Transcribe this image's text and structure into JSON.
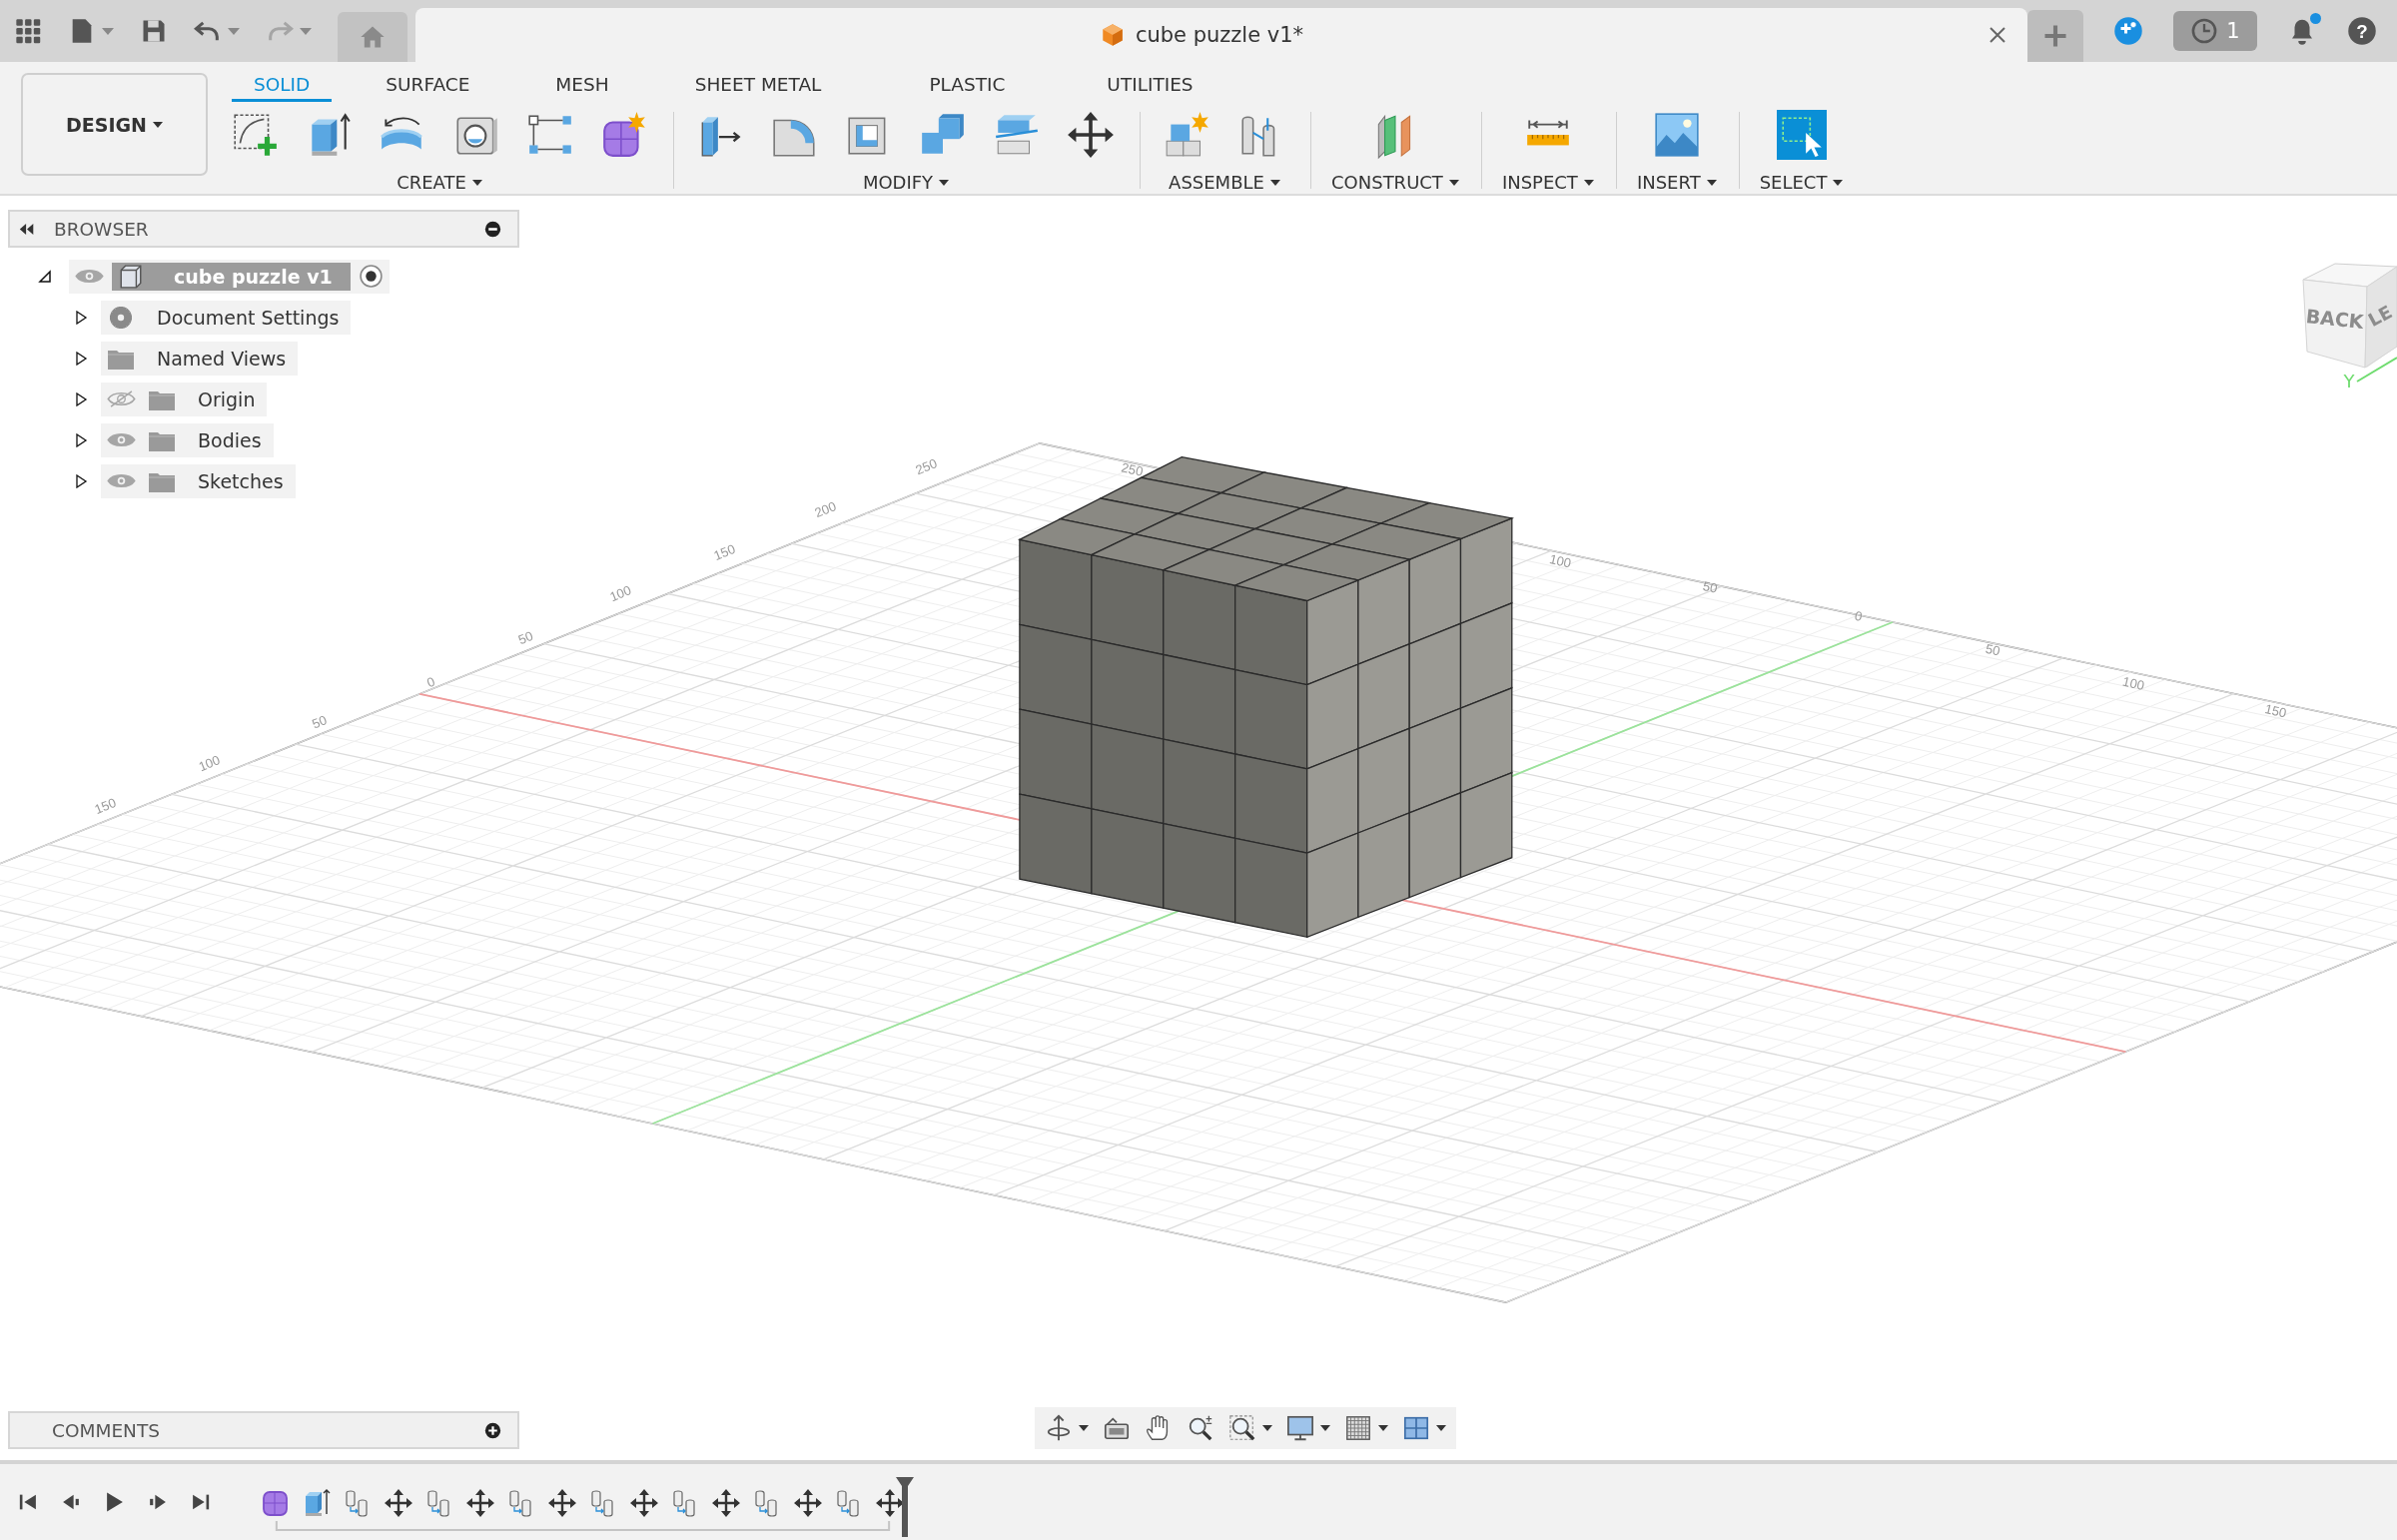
{
  "top_bar": {
    "undo": {
      "disabled": false
    },
    "redo": {
      "disabled": true
    },
    "document_tab": {
      "title": "cube puzzle v1*"
    },
    "job_count": "1",
    "notifications": {
      "unread": true
    },
    "help_label": "?"
  },
  "toolbar": {
    "workspace": "DESIGN",
    "tabs": [
      {
        "label": "SOLID",
        "selected": true
      },
      {
        "label": "SURFACE",
        "selected": false
      },
      {
        "label": "MESH",
        "selected": false
      },
      {
        "label": "SHEET METAL",
        "selected": false
      },
      {
        "label": "PLASTIC",
        "selected": false
      },
      {
        "label": "UTILITIES",
        "selected": false
      }
    ],
    "groups": [
      {
        "label": "CREATE",
        "tools": [
          {
            "kind": "sketch"
          },
          {
            "kind": "extrude"
          },
          {
            "kind": "revolve"
          },
          {
            "kind": "hole"
          },
          {
            "kind": "pattern"
          },
          {
            "kind": "form"
          }
        ]
      },
      {
        "label": "MODIFY",
        "tools": [
          {
            "kind": "press-pull"
          },
          {
            "kind": "fillet"
          },
          {
            "kind": "shell"
          },
          {
            "kind": "combine"
          },
          {
            "kind": "split"
          },
          {
            "kind": "move"
          }
        ]
      },
      {
        "label": "ASSEMBLE",
        "tools": [
          {
            "kind": "new-component"
          },
          {
            "kind": "joint"
          }
        ]
      },
      {
        "label": "CONSTRUCT",
        "tools": [
          {
            "kind": "plane"
          }
        ]
      },
      {
        "label": "INSPECT",
        "tools": [
          {
            "kind": "measure"
          }
        ]
      },
      {
        "label": "INSERT",
        "tools": [
          {
            "kind": "image"
          }
        ]
      },
      {
        "label": "SELECT",
        "tools": [
          {
            "kind": "select"
          }
        ]
      }
    ]
  },
  "browser": {
    "title": "BROWSER",
    "root": {
      "label": "cube puzzle v1",
      "expanded": true,
      "visible": true,
      "active": true,
      "children": [
        {
          "label": "Document Settings",
          "kind": "settings",
          "expanded": false
        },
        {
          "label": "Named Views",
          "kind": "folder",
          "expanded": false
        },
        {
          "label": "Origin",
          "kind": "folder",
          "visible": false,
          "expanded": false
        },
        {
          "label": "Bodies",
          "kind": "folder",
          "visible": true,
          "expanded": false
        },
        {
          "label": "Sketches",
          "kind": "folder",
          "visible": true,
          "expanded": false
        }
      ]
    }
  },
  "viewport": {
    "grid_labels": [
      "250",
      "200",
      "150",
      "100",
      "50",
      "0",
      "50",
      "100",
      "150",
      "250",
      "100",
      "50",
      "0",
      "50",
      "100",
      "150"
    ]
  },
  "viewcube": {
    "faces": [
      "BACK",
      "LE"
    ],
    "axis_label": "Y"
  },
  "comments": {
    "title": "COMMENTS"
  },
  "nav_bar": {
    "tools": [
      {
        "kind": "orbit",
        "menu": true
      },
      {
        "kind": "look-at",
        "menu": false
      },
      {
        "kind": "pan",
        "menu": false
      },
      {
        "kind": "zoom",
        "menu": false
      },
      {
        "kind": "fit",
        "menu": true
      },
      {
        "kind": "display",
        "menu": true
      },
      {
        "kind": "grid",
        "menu": true
      },
      {
        "kind": "viewports",
        "menu": true
      }
    ]
  },
  "timeline": {
    "features": [
      {
        "kind": "form"
      },
      {
        "kind": "extrude"
      },
      {
        "kind": "copy"
      },
      {
        "kind": "move"
      },
      {
        "kind": "copy"
      },
      {
        "kind": "move"
      },
      {
        "kind": "copy"
      },
      {
        "kind": "move"
      },
      {
        "kind": "copy"
      },
      {
        "kind": "move"
      },
      {
        "kind": "copy"
      },
      {
        "kind": "move"
      },
      {
        "kind": "copy"
      },
      {
        "kind": "move"
      },
      {
        "kind": "copy"
      },
      {
        "kind": "move"
      }
    ]
  }
}
